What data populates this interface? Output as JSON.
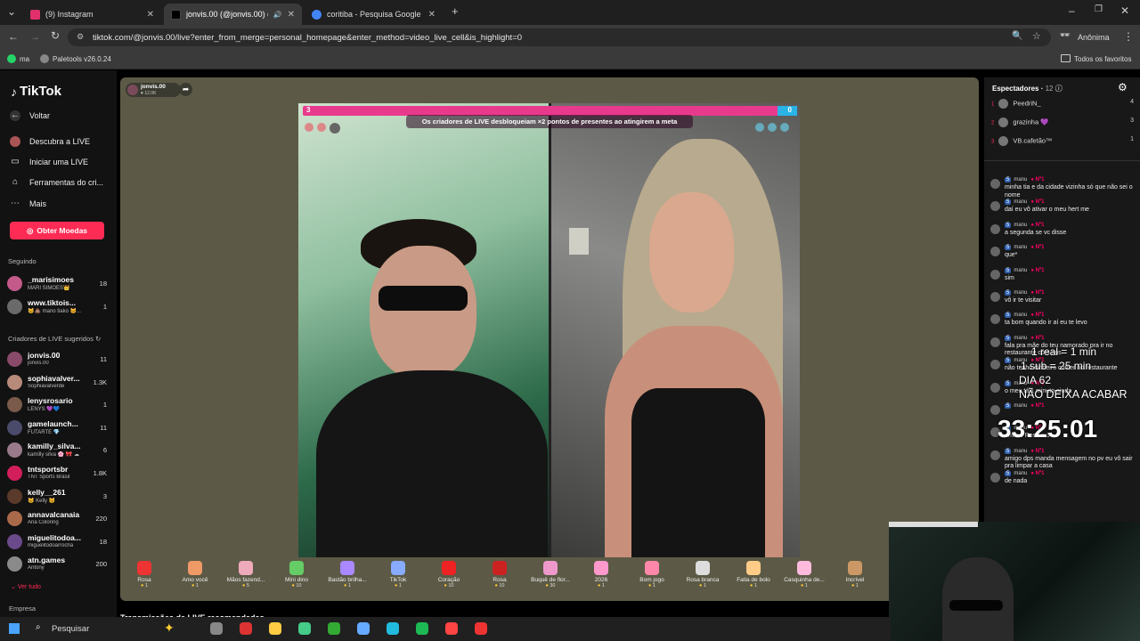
{
  "browser": {
    "tabs": [
      {
        "label": "(9) Instagram",
        "color": "#e1306c"
      },
      {
        "label": "jonvis.00 (@jonvis.00) come",
        "color": "#000000",
        "active": true
      },
      {
        "label": "coritiba - Pesquisa Google",
        "color": "#4285f4"
      }
    ],
    "url": "tiktok.com/@jonvis.00/live?enter_from_merge=personal_homepage&enter_method=video_live_cell&is_highlight=0",
    "profile": "Anônima",
    "bookmarks": [
      "ma",
      "Paletools v26.0.24"
    ],
    "favorites": "Todos os favoritos"
  },
  "sidebar": {
    "logo": "TikTok",
    "back": "Voltar",
    "nav": [
      "Descubra a LIVE",
      "Iniciar uma LIVE",
      "Ferramentas do cri...",
      "Mais"
    ],
    "coins_button": "Obter Moedas",
    "following_title": "Seguindo",
    "following": [
      {
        "name": "_marisimoes",
        "sub": "MARI SIMÕES👑",
        "count": "18",
        "color": "#c35a8a"
      },
      {
        "name": "www.tiktois...",
        "sub": "🐱💩 mano tiako 🐱...",
        "count": "1",
        "color": "#6a6a6a"
      }
    ],
    "suggested_title": "Criadores de LIVE sugeridos",
    "suggested": [
      {
        "name": "jonvis.00",
        "sub": "jonvis.00",
        "count": "11",
        "color": "#8a4a6a"
      },
      {
        "name": "sophiavalver...",
        "sub": "Sophiavalverde",
        "count": "1.3K",
        "color": "#b88a7a"
      },
      {
        "name": "lenysrosario",
        "sub": "LENYS 💜💙",
        "count": "1",
        "color": "#7a5a4a"
      },
      {
        "name": "gamelaunch...",
        "sub": "FUTARTE 💎",
        "count": "11",
        "color": "#4a4a6a"
      },
      {
        "name": "kamilly_silva...",
        "sub": "kamilly silva 🌸 🎀 ☁",
        "count": "6",
        "color": "#9a7a8a"
      },
      {
        "name": "tntsportsbr",
        "sub": "TNT Sports Brasil",
        "count": "1.8K",
        "color": "#d21f5b"
      },
      {
        "name": "kelly__261",
        "sub": "🐱 Kelly 🐱",
        "count": "3",
        "color": "#5a3a2a"
      },
      {
        "name": "annavalcanaia",
        "sub": "Ana Coloring",
        "count": "220",
        "color": "#aa6a4a"
      },
      {
        "name": "miguelitodoa...",
        "sub": "miguelitodoarrocha",
        "count": "18",
        "color": "#6a4a8a"
      },
      {
        "name": "atn.games",
        "sub": "Antony",
        "count": "200",
        "color": "#8a8a8a"
      }
    ],
    "see_all": "Ver tudo",
    "company": "Empresa"
  },
  "live": {
    "host": "jonvis.00",
    "likes": "12.0K",
    "score_left": "3",
    "score_right": "0",
    "banner": "Os criadores de LIVE desbloqueiam ×2 pontos de presentes ao atingirem a meta",
    "recommended": "Transmissões de LIVE recomendadas"
  },
  "gifts": [
    {
      "name": "Rosa",
      "price": "1",
      "color": "#e33"
    },
    {
      "name": "Amo você",
      "price": "1",
      "color": "#e96"
    },
    {
      "name": "Mãos fazend...",
      "price": "5",
      "color": "#eab"
    },
    {
      "name": "Mini dino",
      "price": "10",
      "color": "#6c6"
    },
    {
      "name": "Bastão brilha...",
      "price": "1",
      "color": "#a8f"
    },
    {
      "name": "TikTok",
      "price": "1",
      "color": "#8af"
    },
    {
      "name": "Coração",
      "price": "10",
      "color": "#e22"
    },
    {
      "name": "Rosa",
      "price": "10",
      "color": "#c22"
    },
    {
      "name": "Buquê de flor...",
      "price": "30",
      "color": "#e9c"
    },
    {
      "name": "2026",
      "price": "1",
      "color": "#f9c"
    },
    {
      "name": "Bom jogo",
      "price": "1",
      "color": "#f8a"
    },
    {
      "name": "Rosa branca",
      "price": "1",
      "color": "#ddd"
    },
    {
      "name": "Fatia de bolo",
      "price": "1",
      "color": "#fc8"
    },
    {
      "name": "Casquinha de...",
      "price": "1",
      "color": "#fbd"
    },
    {
      "name": "Incrível",
      "price": "1",
      "color": "#c96"
    }
  ],
  "chat": {
    "viewers_title": "Espectadores",
    "viewers_count": "12",
    "viewers": [
      {
        "rank": "1",
        "name": "PeedriN_",
        "count": "4"
      },
      {
        "rank": "2",
        "name": "grazinha 💜",
        "count": "3"
      },
      {
        "rank": "3",
        "name": "VB.cafetão™",
        "count": "1"
      }
    ],
    "messages": [
      {
        "user": "manu",
        "text": "minha tia e da cidade vizinha só que não sei o nome"
      },
      {
        "user": "manu",
        "text": "daí eu vô ativar o meu hert me"
      },
      {
        "user": "manu",
        "text": "a segunda se vc disse"
      },
      {
        "user": "manu",
        "text": "que*"
      },
      {
        "user": "manu",
        "text": "sim"
      },
      {
        "user": "manu",
        "text": "vô ir te visitar"
      },
      {
        "user": "manu",
        "text": "ta bom quando ir aí eu te levo"
      },
      {
        "user": "manu",
        "text": "fala pra mãe do teu namorado pra ir no restaurante com nós"
      },
      {
        "user": "manu",
        "text": "não tenho dinheiro comer no restaurante"
      },
      {
        "user": "manu",
        "text": "o meu tá 1 minuto ainda"
      },
      {
        "user": "manu",
        "text": ""
      },
      {
        "user": "manu",
        "text": "enviou Rosa × 1"
      },
      {
        "user": "manu",
        "text": "amigo dps manda mensagem no pv eu vô sair pra limpar a casa"
      },
      {
        "user": "manu",
        "text": "de nada"
      }
    ]
  },
  "overlay": {
    "line1": "1 real = 1 min",
    "line2": "1 sub = 25 min",
    "line3": "DIA 62",
    "line4": "NÃO DEIXA ACABAR",
    "timer": "33:25:01"
  },
  "taskbar": {
    "search": "Pesquisar"
  }
}
